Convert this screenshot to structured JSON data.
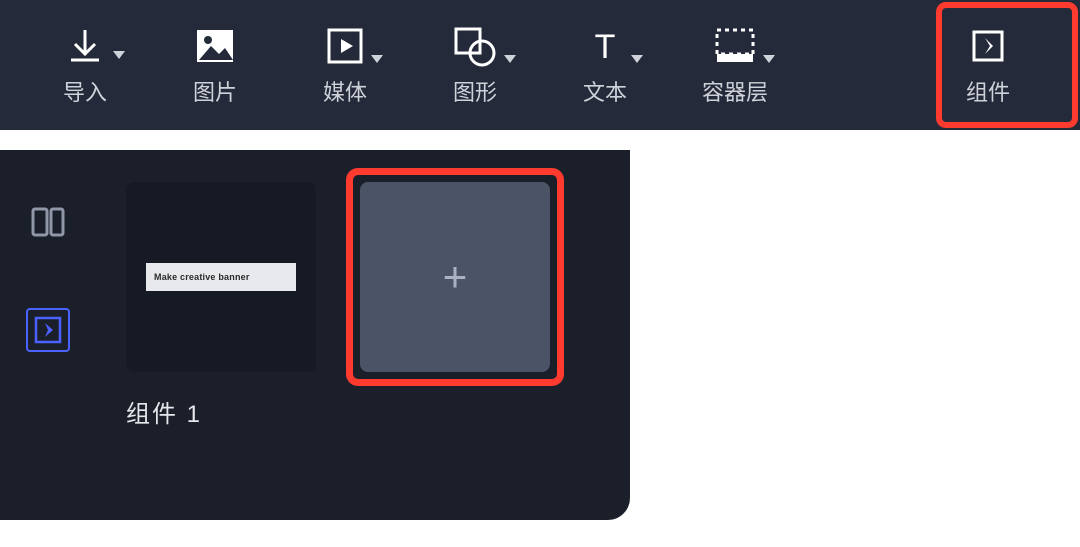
{
  "toolbar": {
    "import": {
      "label": "导入"
    },
    "image": {
      "label": "图片"
    },
    "media": {
      "label": "媒体"
    },
    "shape": {
      "label": "图形"
    },
    "text": {
      "label": "文本"
    },
    "container": {
      "label": "容器层"
    },
    "component": {
      "label": "组件"
    }
  },
  "sidepanel": {
    "cards": [
      {
        "label": "组件 1",
        "preview_text": "Make creative banner"
      }
    ]
  },
  "highlights": {
    "toolbar_component": true,
    "add_tile": true
  },
  "colors": {
    "highlight": "#ff3b30",
    "accent": "#4b62ff"
  }
}
